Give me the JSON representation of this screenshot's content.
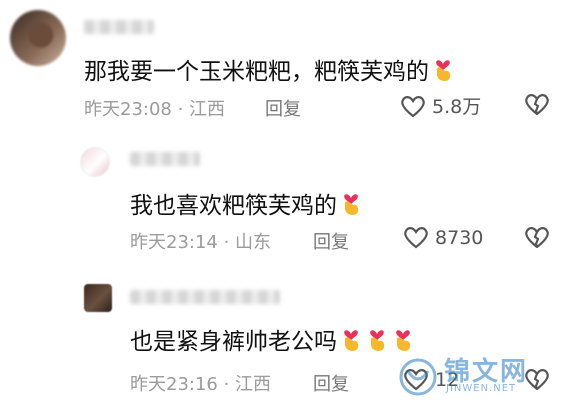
{
  "comments": [
    {
      "text": "那我要一个玉米粑粑，粑筷芙鸡的",
      "time": "昨天23:08",
      "location": "江西",
      "reply_label": "回复",
      "likes": "5.8万",
      "emoji_count": 1
    },
    {
      "text": "我也喜欢粑筷芙鸡的",
      "time": "昨天23:14",
      "location": "山东",
      "reply_label": "回复",
      "likes": "8730",
      "emoji_count": 1
    },
    {
      "text": "也是紧身裤帅老公吗",
      "time": "昨天23:16",
      "location": "江西",
      "reply_label": "回复",
      "likes": "12",
      "emoji_count": 3
    }
  ],
  "watermark": {
    "title": "锦文网",
    "subtitle": "JINWEN.NET"
  },
  "colors": {
    "emoji_hand": "#f5b72c",
    "emoji_heart": "#e8325a",
    "meta_text": "#9b9b9b",
    "watermark": "#2a7cc1"
  }
}
